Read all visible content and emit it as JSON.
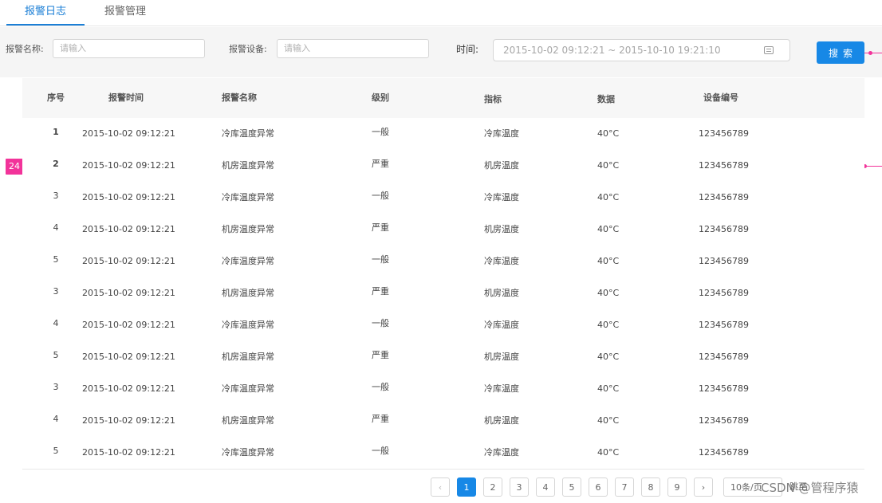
{
  "tabs": [
    {
      "label": "报警日志",
      "active": true
    },
    {
      "label": "报警管理",
      "active": false
    }
  ],
  "search": {
    "name_label": "报警名称:",
    "name_placeholder": "请输入",
    "device_label": "报警设备:",
    "device_placeholder": "请输入",
    "time_label": "时间:",
    "date_range": "2015-10-02 09:12:21 ~ 2015-10-10 19:21:10",
    "button_label": "搜索"
  },
  "table": {
    "headers": {
      "index": "序号",
      "time": "报警时间",
      "name": "报警名称",
      "level": "级别",
      "metric": "指标",
      "data": "数据",
      "device_no": "设备编号"
    },
    "rows": [
      {
        "index": "1",
        "time": "2015-10-02 09:12:21",
        "name": "冷库温度异常",
        "level": "一般",
        "metric": "冷库温度",
        "data": "40°C",
        "device_no": "123456789"
      },
      {
        "index": "2",
        "time": "2015-10-02 09:12:21",
        "name": "机房温度异常",
        "level": "严重",
        "metric": "机房温度",
        "data": "40°C",
        "device_no": "123456789"
      },
      {
        "index": "3",
        "time": "2015-10-02 09:12:21",
        "name": "冷库温度异常",
        "level": "一般",
        "metric": "冷库温度",
        "data": "40°C",
        "device_no": "123456789"
      },
      {
        "index": "4",
        "time": "2015-10-02 09:12:21",
        "name": "机房温度异常",
        "level": "严重",
        "metric": "机房温度",
        "data": "40°C",
        "device_no": "123456789"
      },
      {
        "index": "5",
        "time": "2015-10-02 09:12:21",
        "name": "冷库温度异常",
        "level": "一般",
        "metric": "冷库温度",
        "data": "40°C",
        "device_no": "123456789"
      },
      {
        "index": "3",
        "time": "2015-10-02 09:12:21",
        "name": "机房温度异常",
        "level": "严重",
        "metric": "机房温度",
        "data": "40°C",
        "device_no": "123456789"
      },
      {
        "index": "4",
        "time": "2015-10-02 09:12:21",
        "name": "冷库温度异常",
        "level": "一般",
        "metric": "冷库温度",
        "data": "40°C",
        "device_no": "123456789"
      },
      {
        "index": "5",
        "time": "2015-10-02 09:12:21",
        "name": "机房温度异常",
        "level": "严重",
        "metric": "机房温度",
        "data": "40°C",
        "device_no": "123456789"
      },
      {
        "index": "3",
        "time": "2015-10-02 09:12:21",
        "name": "冷库温度异常",
        "level": "一般",
        "metric": "冷库温度",
        "data": "40°C",
        "device_no": "123456789"
      },
      {
        "index": "4",
        "time": "2015-10-02 09:12:21",
        "name": "机房温度异常",
        "level": "严重",
        "metric": "机房温度",
        "data": "40°C",
        "device_no": "123456789"
      },
      {
        "index": "5",
        "time": "2015-10-02 09:12:21",
        "name": "冷库温度异常",
        "level": "一般",
        "metric": "冷库温度",
        "data": "40°C",
        "device_no": "123456789"
      }
    ]
  },
  "row_marker": "24",
  "pagination": {
    "prev_icon": "chevron-left-icon",
    "pages": [
      "1",
      "2",
      "3",
      "4",
      "5",
      "6",
      "7",
      "8",
      "9"
    ],
    "current_page": "1",
    "next_icon": "chevron-right-icon",
    "page_size": "10条/页",
    "jump_label": "跳至"
  },
  "watermark": "CSDN @管程序猿",
  "colors": {
    "primary": "#1788e6",
    "marker": "#f2339a"
  }
}
